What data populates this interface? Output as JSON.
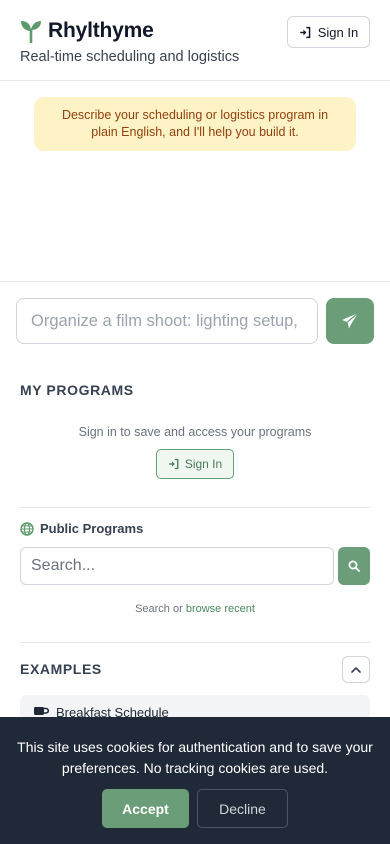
{
  "header": {
    "app_name": "Rhylthyme",
    "tagline": "Real-time scheduling and logistics",
    "signin_label": "Sign In"
  },
  "chat": {
    "intro_message": "Describe your scheduling or logistics program in plain English, and I'll help you build it."
  },
  "composer": {
    "placeholder": "Organize a film shoot: lighting setup, s",
    "send_icon": "paper-plane-icon"
  },
  "my_programs": {
    "title": "MY PROGRAMS",
    "hint": "Sign in to save and access your programs",
    "signin_label": "Sign In"
  },
  "public_programs": {
    "title": "Public Programs",
    "search_placeholder": "Search...",
    "hint_prefix": "Search or",
    "hint_link": "browse recent"
  },
  "examples": {
    "title": "EXAMPLES",
    "items": [
      {
        "label": "Breakfast Schedule",
        "icon": "coffee-mug-icon"
      }
    ]
  },
  "cookie_banner": {
    "message": "This site uses cookies for authentication and to save your preferences. No tracking cookies are used.",
    "accept_label": "Accept",
    "decline_label": "Decline"
  },
  "colors": {
    "accent": "#6b9e78",
    "banner_bg": "#1f2937",
    "bubble_bg": "#fef3c7",
    "bubble_text": "#92400e"
  }
}
